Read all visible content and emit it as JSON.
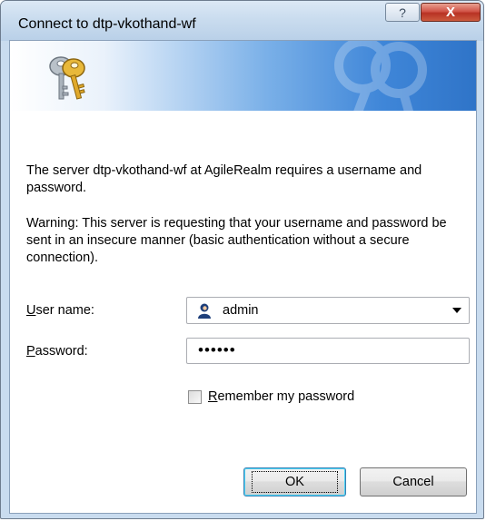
{
  "window": {
    "title": "Connect to dtp-vkothand-wf",
    "help_label": "?",
    "close_label": "X"
  },
  "message": {
    "line1": "The server dtp-vkothand-wf at AgileRealm requires a username and password.",
    "warning": "Warning: This server is requesting that your username and password be sent in an insecure manner (basic authentication without a secure connection)."
  },
  "form": {
    "username_label_accel": "U",
    "username_label_rest": "ser name:",
    "username_value": "admin",
    "password_label_accel": "P",
    "password_label_rest": "assword:",
    "password_value": "••••••",
    "remember_accel": "R",
    "remember_rest": "emember my password",
    "remember_checked": false
  },
  "buttons": {
    "ok": "OK",
    "cancel": "Cancel"
  },
  "colors": {
    "banner_blue": "#3f86d8",
    "close_red": "#c7493a"
  },
  "icons": {
    "banner": "keys-icon",
    "user": "user-account-icon",
    "dropdown": "chevron-down-icon"
  }
}
